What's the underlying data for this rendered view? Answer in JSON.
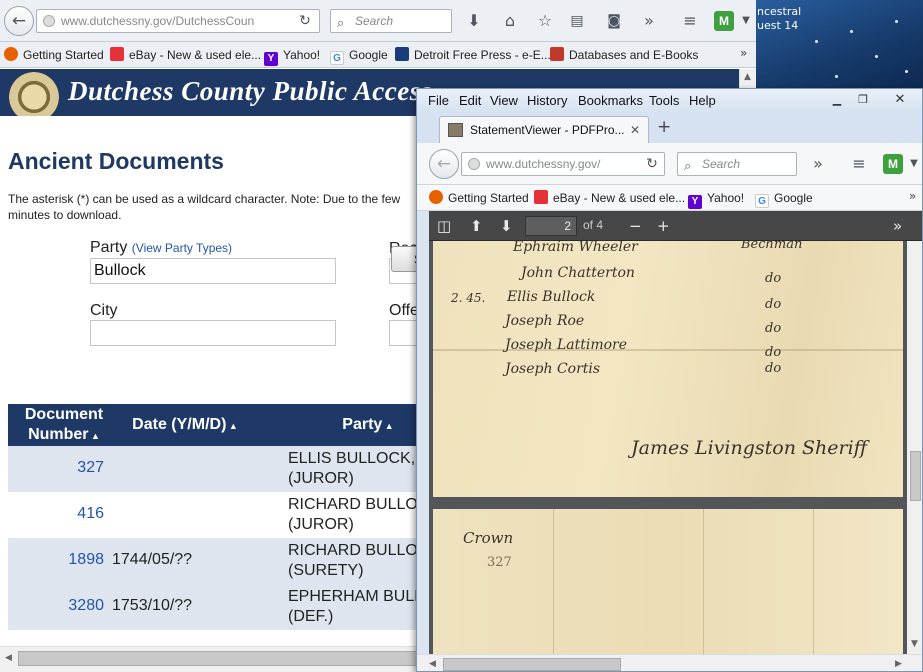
{
  "desktop": {
    "text_line1": "ncestral",
    "text_line2": "uest 14"
  },
  "back_browser": {
    "url": "www.dutchessny.gov/DutchessCoun",
    "search_placeholder": "Search",
    "bookmarks": [
      {
        "label": "Getting Started",
        "icon": "firefox-icon"
      },
      {
        "label": "eBay - New & used ele...",
        "icon": "ebay-icon"
      },
      {
        "label": "Yahoo!",
        "icon": "yahoo-icon"
      },
      {
        "label": "Google",
        "icon": "google-icon"
      },
      {
        "label": "Detroit Free Press - e-E...",
        "icon": "dfp-icon"
      },
      {
        "label": "Databases and E-Books",
        "icon": "databases-icon"
      }
    ],
    "overflow": "»"
  },
  "site": {
    "banner_title": "Dutchess County Public Access",
    "page_title": "Ancient Documents",
    "note": "The asterisk (*) can be used as a wildcard character. Note: Due to the few minutes to download.",
    "form": {
      "party_label": "Party",
      "party_link": "(View Party Types)",
      "party_value": "Bullock",
      "record_label": "Rec",
      "city_label": "City",
      "city_value": "",
      "office_label": "Offe",
      "search_button": "S"
    },
    "table": {
      "headers": [
        "Document Number",
        "Date (Y/M/D)",
        "Party"
      ],
      "header_line1": "Document",
      "header_line2": "Number",
      "rows": [
        {
          "number": "327",
          "date": "",
          "party_line1": "ELLIS BULLOCK,",
          "party_line2": "(JUROR)"
        },
        {
          "number": "416",
          "date": "",
          "party_line1": "RICHARD BULLOC",
          "party_line2": "(JUROR)"
        },
        {
          "number": "1898",
          "date": "1744/05/??",
          "party_line1": "RICHARD BULLOC",
          "party_line2": "(SURETY)"
        },
        {
          "number": "3280",
          "date": "1753/10/??",
          "party_line1": "EPHERHAM BULL",
          "party_line2": "(DEF.)"
        }
      ]
    }
  },
  "front_browser": {
    "menus": [
      "File",
      "Edit",
      "View",
      "History",
      "Bookmarks",
      "Tools",
      "Help"
    ],
    "tab_title": "StatementViewer - PDFPro...",
    "url": "www.dutchessny.gov/",
    "search_placeholder": "Search",
    "bookmarks": [
      {
        "label": "Getting Started"
      },
      {
        "label": "eBay - New & used ele..."
      },
      {
        "label": "Yahoo!"
      },
      {
        "label": "Google"
      }
    ],
    "pdf": {
      "page": "2",
      "of": "of 4"
    },
    "manuscript": {
      "col_header": "Bechman",
      "names": [
        "Ephraim Wheeler",
        "John Chatterton",
        "Ellis Bullock",
        "Joseph Roe",
        "Joseph Lattimore",
        "Joseph Cortis"
      ],
      "mark": "2. 45.",
      "ditto": "do",
      "signature": "James Livingston Sheriff",
      "page3_label": "Crown",
      "page3_number": "327"
    }
  }
}
